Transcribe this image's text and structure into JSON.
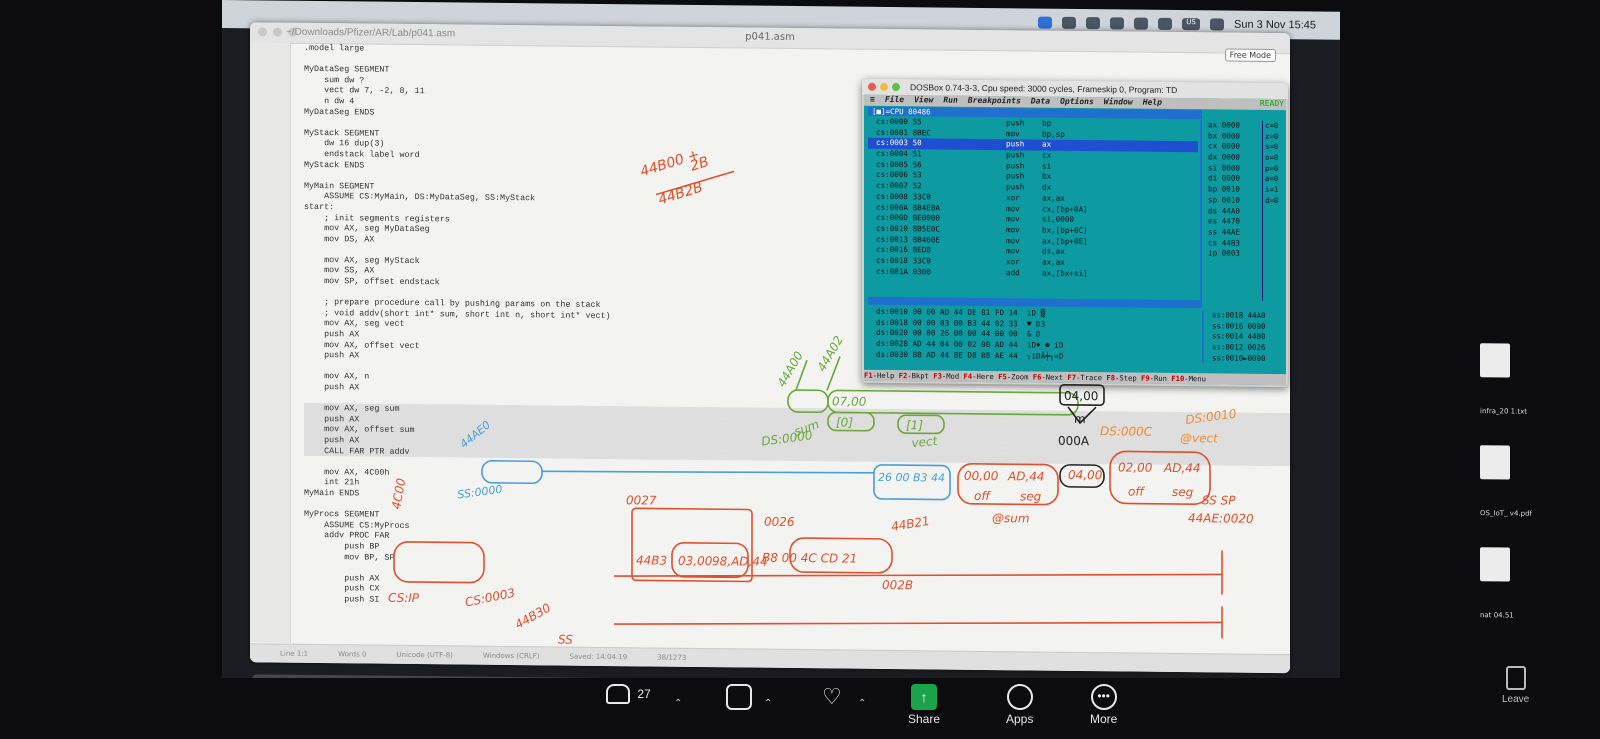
{
  "menubar": {
    "clock": "Sun 3 Nov 15:45",
    "badge": "US"
  },
  "editor": {
    "path": "~/Downloads/Pfizer/AR/Lab/p041.asm",
    "filename": "p041.asm",
    "free_mode": "Free Mode",
    "lines": [
      ".model large",
      "",
      "MyDataSeg SEGMENT",
      "    sum dw ?",
      "    vect dw 7, -2, 8, 11",
      "    n dw 4",
      "MyDataSeg ENDS",
      "",
      "MyStack SEGMENT",
      "    dw 16 dup(3)",
      "    endstack label word",
      "MyStack ENDS",
      "",
      "MyMain SEGMENT",
      "    ASSUME CS:MyMain, DS:MyDataSeg, SS:MyStack",
      "start:",
      "    ; init segments registers",
      "    mov AX, seg MyDataSeg",
      "    mov DS, AX",
      "",
      "    mov AX, seg MyStack",
      "    mov SS, AX",
      "    mov SP, offset endstack",
      "",
      "    ; prepare procedure call by pushing params on the stack",
      "    ; void addv(short int* sum, short int n, short int* vect)",
      "    mov AX, seg vect",
      "    push AX",
      "    mov AX, offset vect",
      "    push AX",
      "",
      "    mov AX, n",
      "    push AX",
      "",
      "    mov AX, seg sum",
      "    push AX",
      "    mov AX, offset sum",
      "    push AX",
      "    CALL FAR PTR addv",
      "",
      "    mov AX, 4C00h",
      "    int 21h",
      "MyMain ENDS",
      "",
      "MyProcs SEGMENT",
      "    ASSUME CS:MyProcs",
      "    addv PROC FAR",
      "        push BP",
      "        mov BP, SP",
      "",
      "        push AX",
      "        push CX",
      "        push SI"
    ],
    "status": [
      "Line 1:1",
      "Words 0",
      "Unicode (UTF-8)",
      "Windows (CRLF)",
      "Saved: 14:04:19",
      "38/1273"
    ]
  },
  "dosbox": {
    "title": "DOSBox 0.74-3-3, Cpu speed:   3000 cycles, Frameskip  0, Program:    TD",
    "menu": [
      "≡",
      "File",
      "View",
      "Run",
      "Breakpoints",
      "Data",
      "Options",
      "Window",
      "Help"
    ],
    "ready": "READY",
    "cpu_title": "[■]=CPU 80486",
    "cpu_rows": [
      {
        "addr": "cs:0000 55",
        "mn": "push",
        "op": "bp"
      },
      {
        "addr": "cs:0001 8BEC",
        "mn": "mov",
        "op": "bp,sp"
      },
      {
        "addr": "cs:0003 50",
        "mn": "push",
        "op": "ax",
        "sel": true
      },
      {
        "addr": "cs:0004 51",
        "mn": "push",
        "op": "cx"
      },
      {
        "addr": "cs:0005 56",
        "mn": "push",
        "op": "si"
      },
      {
        "addr": "cs:0006 53",
        "mn": "push",
        "op": "bx"
      },
      {
        "addr": "cs:0007 52",
        "mn": "push",
        "op": "dx"
      },
      {
        "addr": "cs:0008 33C0",
        "mn": "xor",
        "op": "ax,ax"
      },
      {
        "addr": "cs:000A 8B4E0A",
        "mn": "mov",
        "op": "cx,[bp+0A]"
      },
      {
        "addr": "cs:000D BE0000",
        "mn": "mov",
        "op": "si,0000"
      },
      {
        "addr": "cs:0010 8B5E0C",
        "mn": "mov",
        "op": "bx,[bp+0C]"
      },
      {
        "addr": "cs:0013 8B460E",
        "mn": "mov",
        "op": "ax,[bp+0E]"
      },
      {
        "addr": "cs:0016 8ED8",
        "mn": "mov",
        "op": "ds,ax"
      },
      {
        "addr": "cs:0018 33C0",
        "mn": "xor",
        "op": "ax,ax"
      },
      {
        "addr": "cs:001A 0300",
        "mn": "add",
        "op": "ax,[bx+si]"
      }
    ],
    "regs": [
      "ax 0000",
      "bx 0000",
      "cx 0000",
      "dx 0000",
      "si 0000",
      "di 0000",
      "bp 0010",
      "sp 0010",
      "ds 44A0",
      "es 4470",
      "ss 44AE",
      "cs 44B3",
      "ip 0003"
    ],
    "flags": [
      "c=0",
      "z=0",
      "s=0",
      "o=0",
      "p=0",
      "a=0",
      "i=1",
      "d=0"
    ],
    "mem_rows": [
      "ds:0010 00 00 AD 44 DE 81 FD 14  iD ▒",
      "ds:0018 00 00 03 00 B3 44 02 33  ♥ D3",
      "ds:0020 00 00 26 00 00 44 00 00  & D",
      "ds:0028 AD 44 04 00 02 00 AD 44  iD♦ ☻ iD",
      "ds:0030 B8 AD 44 8E D8 B8 AE 44  ┐iDÄ╪┐«D"
    ],
    "stack_rows": [
      "ss:0018 44A0",
      "ss:0016 0000",
      "ss:0014 44B0",
      "ss:0012 0026",
      "ss:0010►0000"
    ],
    "fkeys": [
      {
        "k": "F1",
        "t": "-Help "
      },
      {
        "k": "F2",
        "t": "-Bkpt "
      },
      {
        "k": "F3",
        "t": "-Mod "
      },
      {
        "k": "F4",
        "t": "-Here "
      },
      {
        "k": "F5",
        "t": "-Zoom "
      },
      {
        "k": "F6",
        "t": "-Next "
      },
      {
        "k": "F7",
        "t": "-Trace "
      },
      {
        "k": "F8",
        "t": "-Step "
      },
      {
        "k": "F9",
        "t": "-Run "
      },
      {
        "k": "F10",
        "t": "-Menu"
      }
    ]
  },
  "side_files": [
    "infra_20 1.txt",
    "OS_IoT_ v4.pdf",
    "nat 04.51"
  ],
  "annotations": {
    "calc": [
      "44B00 +",
      "2B",
      "44B2B"
    ],
    "labels": [
      "44A00",
      "44A02",
      "DS:0000",
      "sum",
      "vect",
      "DS:000C",
      "@vect",
      "DS:0010",
      "m",
      "000A",
      "[0]",
      "[1]",
      "off",
      "seg",
      "@sum",
      "SS SP",
      "44AE:0020",
      "SS:0000",
      "44AE0",
      "CS:IP",
      "CS:0003",
      "0026",
      "002B",
      "44B21",
      "002B",
      "44B30",
      "SS",
      "4C00",
      "0027",
      "26 00 B3 44",
      "07,00",
      "04,00",
      "00,00",
      "AD,44",
      "04,00",
      "02,00",
      "AD,44",
      "B8 00 4C CD 21",
      "9A",
      "0P",
      "44B3",
      "03,00",
      "98,AD,44"
    ]
  },
  "zoom": {
    "participants": "27",
    "items": [
      "Share",
      "Apps",
      "More"
    ],
    "leave": "Leave"
  }
}
